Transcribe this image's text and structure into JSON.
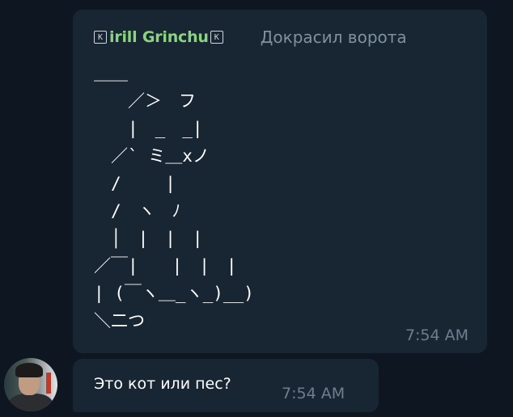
{
  "messages": [
    {
      "flag_left": "K",
      "sender_name": "irill Grinchu",
      "flag_right": "K",
      "header_text": "Докрасил ворота",
      "ascii_art": "＿＿\n　　／＞　フ\n　　|　_　_|\n　／` ミ＿xノ\n　/　　 |\n　/　ヽ　ﾉ\n　│　|　|　|\n／￣|　　|　|　|\n| (￣ヽ＿_ヽ_)__)\n＼二つ",
      "time": "7:54 AM"
    },
    {
      "text": "Это кот или пес?",
      "time": "7:54 AM"
    }
  ]
}
